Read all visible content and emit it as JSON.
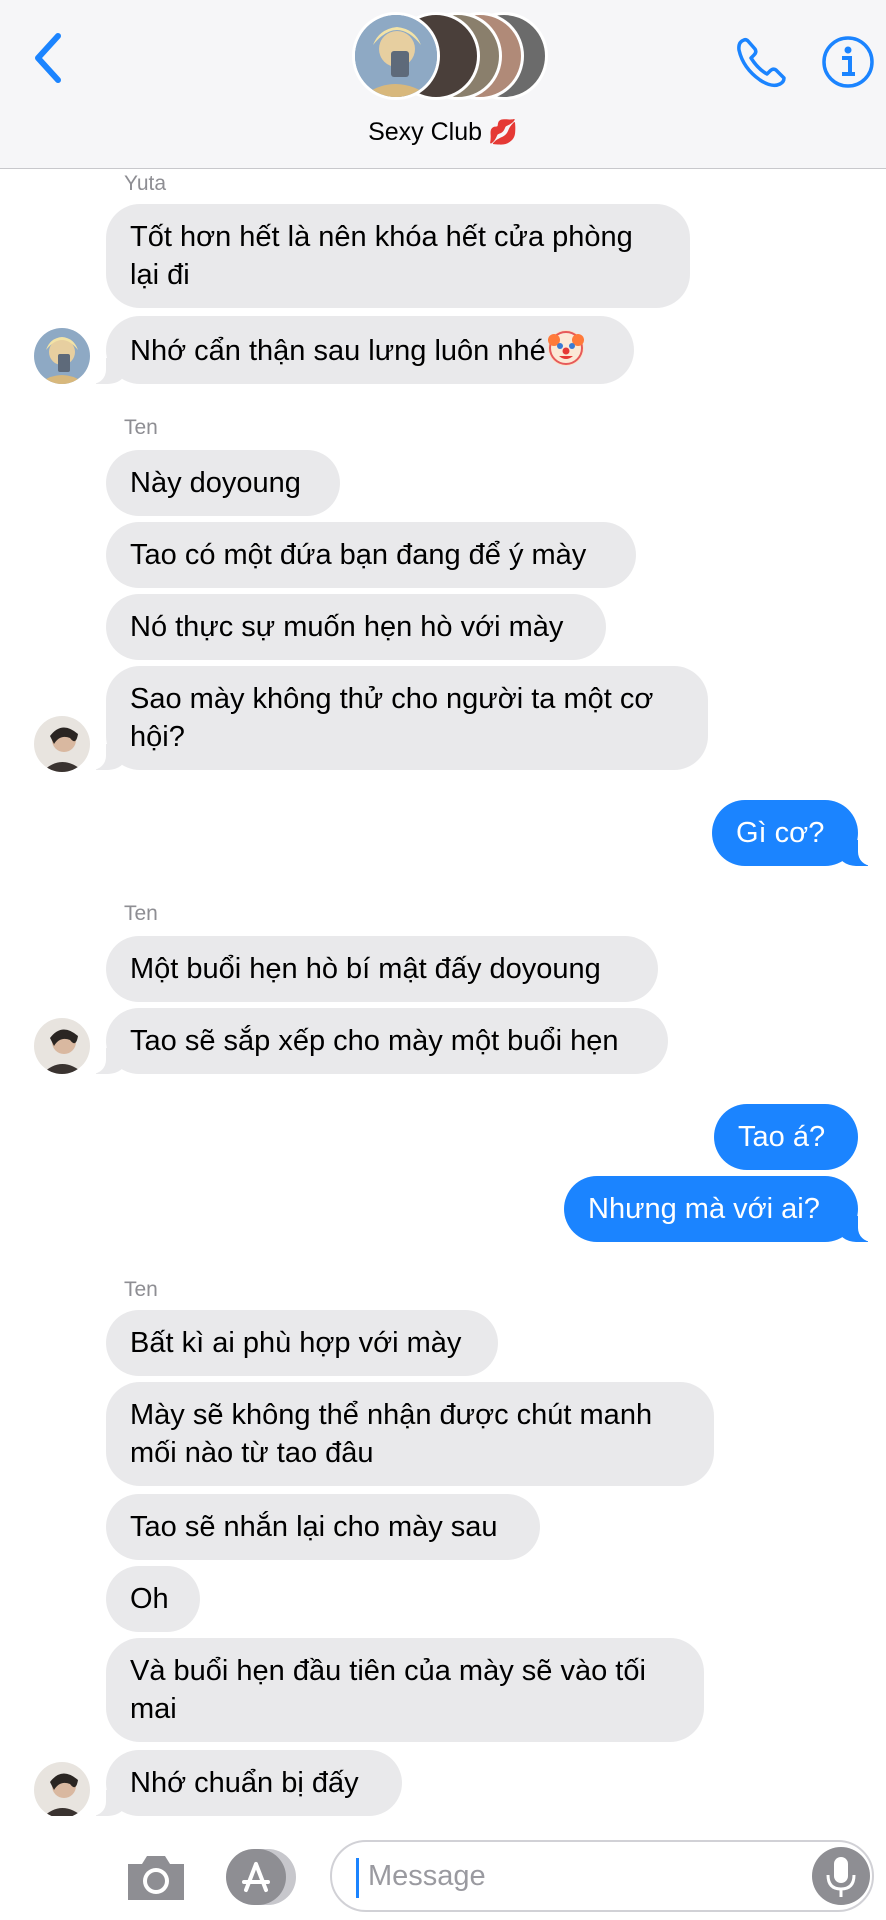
{
  "header": {
    "title": "Sexy Club",
    "title_emoji": "💋",
    "back_icon": "chevron-left-icon",
    "call_icon": "phone-icon",
    "info_icon": "info-icon"
  },
  "colors": {
    "accent": "#1b84ff",
    "incoming_bubble": "#e9e9eb",
    "sender_name": "#8e8e93"
  },
  "conversation": [
    {
      "sender": "Yuta",
      "messages": [
        "Tốt hơn hết là nên khóa hết cửa phòng lại đi",
        "Nhớ cẩn thận sau lưng luôn nhé"
      ],
      "emoji": "🤡"
    },
    {
      "sender": "Ten",
      "messages": [
        "Này doyoung",
        "Tao có một đứa bạn đang để ý mày",
        "Nó thực sự muốn hẹn hò với mày",
        "Sao mày không thử cho người ta một cơ hội?"
      ]
    },
    {
      "sender": "me",
      "messages": [
        "Gì cơ?"
      ]
    },
    {
      "sender": "Ten",
      "messages": [
        "Một buổi hẹn hò bí mật đấy doyoung",
        "Tao sẽ sắp xếp cho mày một buổi hẹn"
      ]
    },
    {
      "sender": "me",
      "messages": [
        "Tao á?",
        "Nhưng mà với ai?"
      ]
    },
    {
      "sender": "Ten",
      "messages": [
        "Bất kì ai phù hợp với mày",
        "Mày sẽ không thể nhận được chút manh mối nào từ tao đâu",
        "Tao sẽ nhắn lại cho mày sau",
        "Oh",
        "Và buổi hẹn đầu tiên của mày sẽ vào tối mai",
        "Nhớ chuẩn bị đấy"
      ]
    }
  ],
  "composer": {
    "placeholder": "Message",
    "camera_icon": "camera-icon",
    "apps_icon": "app-store-icon",
    "mic_icon": "microphone-icon"
  }
}
